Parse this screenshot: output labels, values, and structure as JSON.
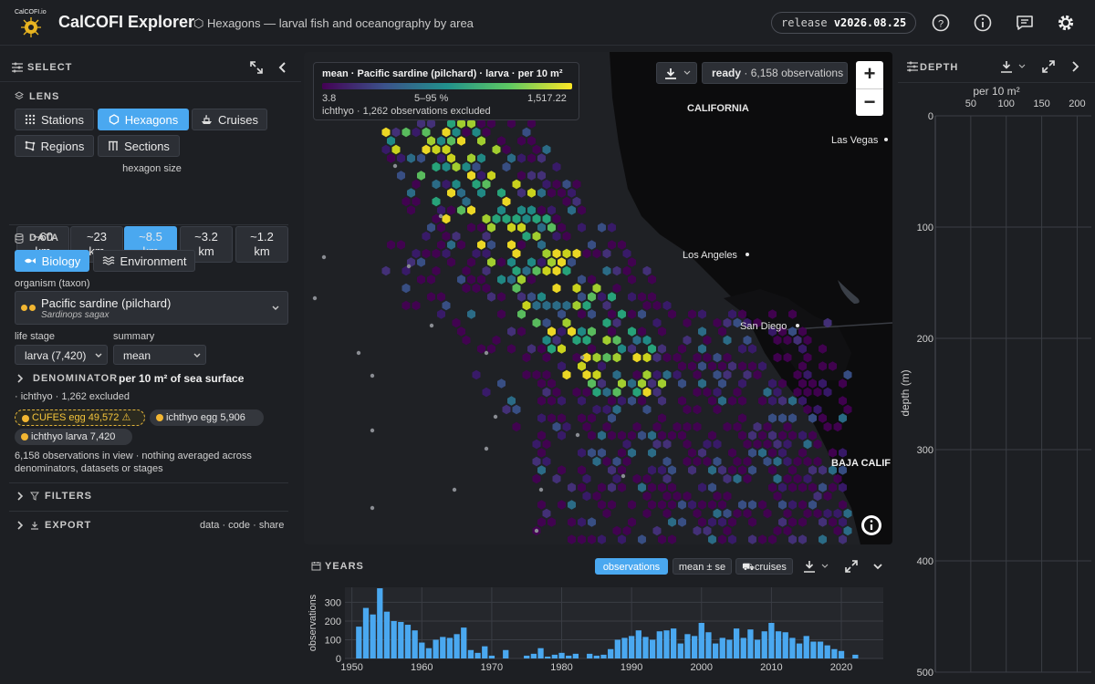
{
  "app": {
    "logo_text": "CalCOFI.io",
    "title": "CalCOFI Explorer",
    "subtitle": "⬡ Hexagons — larval fish and oceanography by area",
    "release_label": "release",
    "release_version": "v2026.08.25"
  },
  "select": {
    "header": "SELECT",
    "lens": {
      "header": "LENS",
      "buttons": [
        {
          "label": "Stations",
          "icon": "grid-dots-icon",
          "active": false
        },
        {
          "label": "Hexagons",
          "icon": "hexagon-icon",
          "active": true
        },
        {
          "label": "Cruises",
          "icon": "ship-icon",
          "active": false
        },
        {
          "label": "Regions",
          "icon": "regions-icon",
          "active": false
        },
        {
          "label": "Sections",
          "icon": "sections-icon",
          "active": false
        }
      ],
      "hexagon_size_label": "hexagon size",
      "hexagon_sizes": [
        {
          "value": "~60",
          "unit": "km",
          "active": false
        },
        {
          "value": "~23",
          "unit": "km",
          "active": false
        },
        {
          "value": "~8.5",
          "unit": "km",
          "active": true
        },
        {
          "value": "~3.2",
          "unit": "km",
          "active": false
        },
        {
          "value": "~1.2",
          "unit": "km",
          "active": false
        }
      ]
    },
    "data": {
      "header": "DATA",
      "tabs": [
        {
          "label": "Biology",
          "icon": "fish-icon",
          "active": true
        },
        {
          "label": "Environment",
          "icon": "waves-icon",
          "active": false
        }
      ],
      "organism_label": "organism (taxon)",
      "organism_common": "Pacific sardine (pilchard)",
      "organism_scientific": "Sardinops sagax",
      "life_stage_label": "life stage",
      "life_stage_value": "larva (7,420)",
      "summary_label": "summary",
      "summary_value": "mean",
      "denominator_label": "DENOMINATOR",
      "denominator_value": "per 10 m² of sea surface",
      "denominator_note": "· ichthyo · 1,262 excluded",
      "chips": [
        {
          "label": "CUFES egg 49,572 ⚠",
          "warn": true
        },
        {
          "label": "ichthyo egg 5,906",
          "warn": false
        },
        {
          "label": "ichthyo larva 7,420",
          "warn": false
        }
      ],
      "note": "6,158 observations in view · nothing averaged across denominators, datasets or stages"
    },
    "filters_label": "FILTERS",
    "export_label": "EXPORT",
    "export_links": "data · code · share"
  },
  "map": {
    "legend_title": "mean · Pacific sardine (pilchard) · larva · per 10 m²",
    "legend_min": "3.8",
    "legend_mid": "5–95 %",
    "legend_max": "1,517.22",
    "legend_note": "ichthyo · 1,262 observations excluded",
    "status_word": "ready",
    "status_detail": "· 6,158 observations",
    "labels": {
      "california": "CALIFORNIA",
      "las_vegas": "Las Vegas",
      "los_angeles": "Los Angeles",
      "san_diego": "San Diego",
      "baja": "BAJA CALIF"
    },
    "zoom_in": "+",
    "zoom_out": "−",
    "colors": {
      "low": "#440154",
      "mid": "#21918c",
      "high": "#fde725",
      "accent": "#4aa8f0"
    }
  },
  "years": {
    "header": "YEARS",
    "toggles": [
      {
        "label": "observations",
        "active": true
      },
      {
        "label": "mean ± se",
        "active": false
      },
      {
        "label": "⛟cruises",
        "active": false
      }
    ]
  },
  "depth": {
    "header": "DEPTH",
    "x_title": "per 10 m²",
    "x_ticks": [
      "50",
      "100",
      "150",
      "200"
    ],
    "y_title": "depth (m)",
    "y_ticks": [
      "0",
      "100",
      "200",
      "300",
      "400",
      "500"
    ]
  },
  "chart_data": [
    {
      "type": "bar",
      "title": "",
      "xlabel": "",
      "ylabel": "observations",
      "ylim": [
        0,
        380
      ],
      "xlim": [
        1949,
        2026
      ],
      "x_ticks": [
        1950,
        1960,
        1970,
        1980,
        1990,
        2000,
        2010,
        2020
      ],
      "y_ticks": [
        0,
        100,
        200,
        300
      ],
      "x": [
        1951,
        1952,
        1953,
        1954,
        1955,
        1956,
        1957,
        1958,
        1959,
        1960,
        1961,
        1962,
        1963,
        1964,
        1965,
        1966,
        1967,
        1968,
        1969,
        1970,
        1972,
        1975,
        1976,
        1977,
        1978,
        1979,
        1980,
        1981,
        1982,
        1984,
        1985,
        1986,
        1987,
        1988,
        1989,
        1990,
        1991,
        1992,
        1993,
        1994,
        1995,
        1996,
        1997,
        1998,
        1999,
        2000,
        2001,
        2002,
        2003,
        2004,
        2005,
        2006,
        2007,
        2008,
        2009,
        2010,
        2011,
        2012,
        2013,
        2014,
        2015,
        2016,
        2017,
        2018,
        2019,
        2020,
        2022
      ],
      "values": [
        170,
        270,
        235,
        375,
        250,
        200,
        195,
        180,
        150,
        85,
        55,
        100,
        115,
        110,
        130,
        165,
        45,
        30,
        65,
        15,
        45,
        15,
        25,
        55,
        10,
        20,
        30,
        15,
        25,
        25,
        15,
        20,
        50,
        100,
        110,
        120,
        150,
        115,
        100,
        145,
        150,
        160,
        80,
        130,
        120,
        190,
        140,
        80,
        110,
        100,
        160,
        110,
        155,
        100,
        145,
        190,
        145,
        140,
        110,
        80,
        120,
        90,
        90,
        70,
        50,
        40,
        20
      ]
    },
    {
      "type": "line",
      "title": "",
      "xlabel": "per 10 m²",
      "ylabel": "depth (m)",
      "xlim": [
        0,
        220
      ],
      "ylim": [
        0,
        500
      ],
      "x_ticks": [
        50,
        100,
        150,
        200
      ],
      "y_ticks": [
        0,
        100,
        200,
        300,
        400,
        500
      ],
      "series": []
    }
  ]
}
